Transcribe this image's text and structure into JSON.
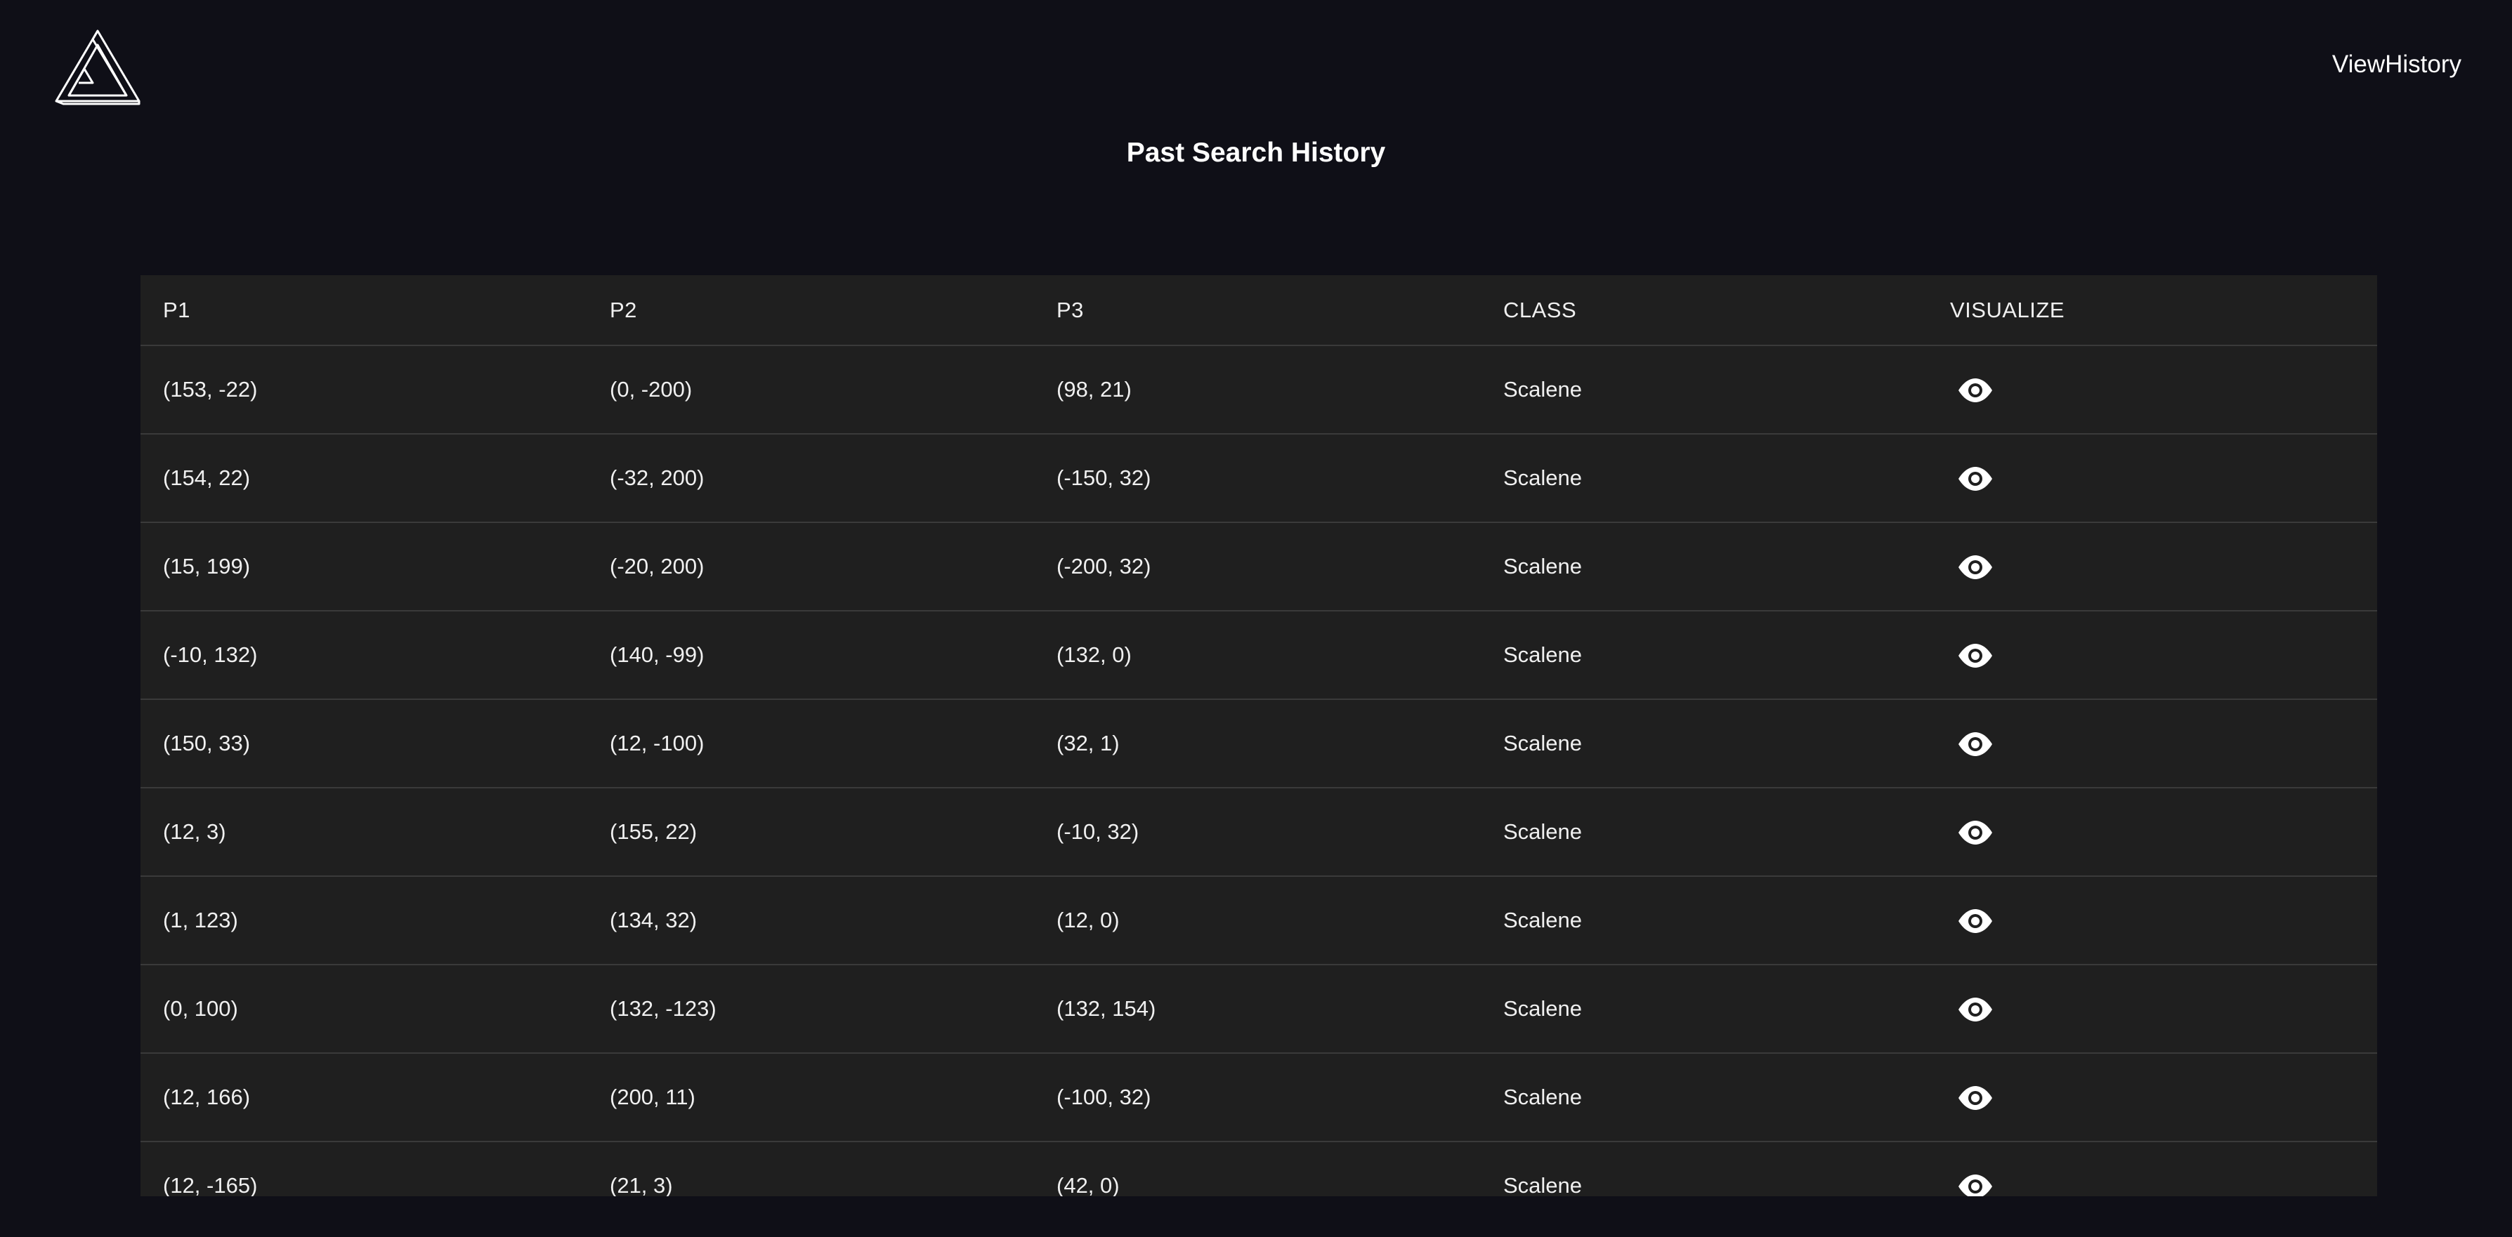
{
  "nav": {
    "logo_icon": "impossible-triangle-logo",
    "view_history_label": "ViewHistory"
  },
  "page_title": "Past Search History",
  "table": {
    "headers": [
      "P1",
      "P2",
      "P3",
      "CLASS",
      "VISUALIZE"
    ],
    "visualize_icon": "eye-icon",
    "rows": [
      {
        "p1": "(153, -22)",
        "p2": "(0, -200)",
        "p3": "(98, 21)",
        "class": "Scalene"
      },
      {
        "p1": "(154, 22)",
        "p2": "(-32, 200)",
        "p3": "(-150, 32)",
        "class": "Scalene"
      },
      {
        "p1": "(15, 199)",
        "p2": "(-20, 200)",
        "p3": "(-200, 32)",
        "class": "Scalene"
      },
      {
        "p1": "(-10, 132)",
        "p2": "(140, -99)",
        "p3": "(132, 0)",
        "class": "Scalene"
      },
      {
        "p1": "(150, 33)",
        "p2": "(12, -100)",
        "p3": "(32, 1)",
        "class": "Scalene"
      },
      {
        "p1": "(12, 3)",
        "p2": "(155, 22)",
        "p3": "(-10, 32)",
        "class": "Scalene"
      },
      {
        "p1": "(1, 123)",
        "p2": "(134, 32)",
        "p3": "(12, 0)",
        "class": "Scalene"
      },
      {
        "p1": "(0, 100)",
        "p2": "(132, -123)",
        "p3": "(132, 154)",
        "class": "Scalene"
      },
      {
        "p1": "(12, 166)",
        "p2": "(200, 11)",
        "p3": "(-100, 32)",
        "class": "Scalene"
      },
      {
        "p1": "(12, -165)",
        "p2": "(21, 3)",
        "p3": "(42, 0)",
        "class": "Scalene"
      }
    ]
  },
  "colors": {
    "background": "#0f0f17",
    "table_background": "#1f1f1f",
    "row_divider": "#3a3a3a",
    "text": "#f0f0f0"
  }
}
